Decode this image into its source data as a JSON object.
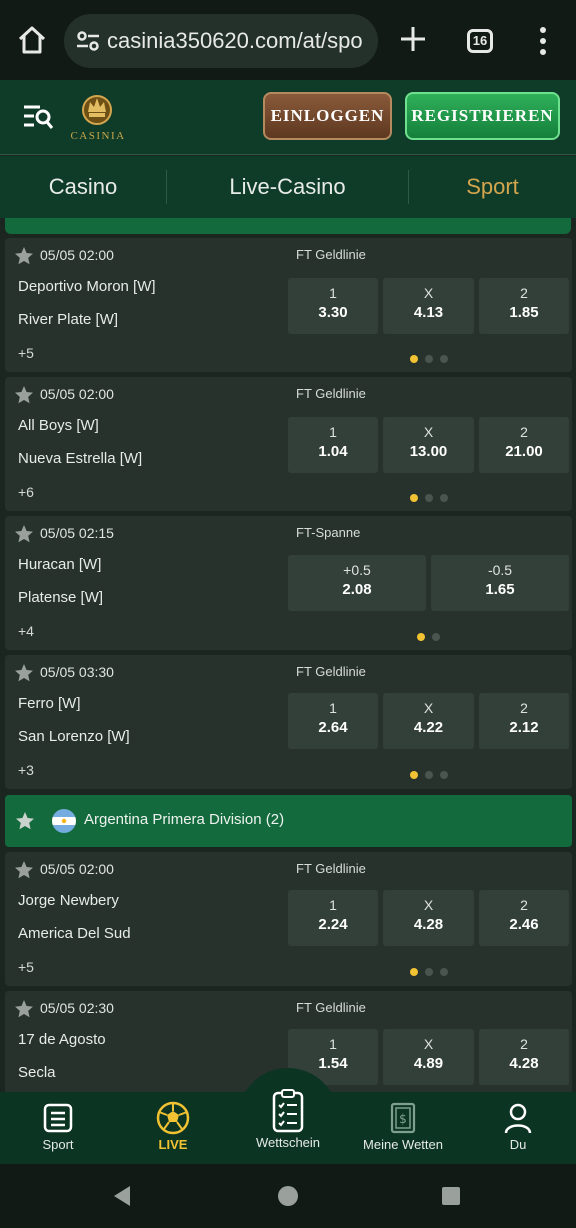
{
  "browser": {
    "url": "casinia350620.com/at/spo",
    "tab_count": "16"
  },
  "header": {
    "logo_text": "CASINIA",
    "login_label": "EINLOGGEN",
    "register_label": "REGISTRIEREN"
  },
  "nav": {
    "tabs": [
      "Casino",
      "Live-Casino",
      "Sport"
    ],
    "active": "Sport"
  },
  "matches": [
    {
      "datetime": "05/05  02:00",
      "market": "FT Geldlinie",
      "home": "Deportivo Moron [W]",
      "away": "River Plate [W]",
      "more": "+5",
      "odds": [
        {
          "label": "1",
          "value": "3.30"
        },
        {
          "label": "X",
          "value": "4.13"
        },
        {
          "label": "2",
          "value": "1.85"
        }
      ]
    },
    {
      "datetime": "05/05  02:00",
      "market": "FT Geldlinie",
      "home": "All Boys [W]",
      "away": "Nueva Estrella [W]",
      "more": "+6",
      "odds": [
        {
          "label": "1",
          "value": "1.04"
        },
        {
          "label": "X",
          "value": "13.00"
        },
        {
          "label": "2",
          "value": "21.00"
        }
      ]
    },
    {
      "datetime": "05/05  02:15",
      "market": "FT-Spanne",
      "home": "Huracan [W]",
      "away": "Platense [W]",
      "more": "+4",
      "odds": [
        {
          "label": "+0.5",
          "value": "2.08"
        },
        {
          "label": "-0.5",
          "value": "1.65"
        }
      ]
    },
    {
      "datetime": "05/05  03:30",
      "market": "FT Geldlinie",
      "home": "Ferro [W]",
      "away": "San Lorenzo [W]",
      "more": "+3",
      "odds": [
        {
          "label": "1",
          "value": "2.64"
        },
        {
          "label": "X",
          "value": "4.22"
        },
        {
          "label": "2",
          "value": "2.12"
        }
      ]
    },
    {
      "datetime": "05/05  02:00",
      "market": "FT Geldlinie",
      "home": "Jorge Newbery",
      "away": "America Del Sud",
      "more": "+5",
      "odds": [
        {
          "label": "1",
          "value": "2.24"
        },
        {
          "label": "X",
          "value": "4.28"
        },
        {
          "label": "2",
          "value": "2.46"
        }
      ]
    },
    {
      "datetime": "05/05  02:30",
      "market": "FT Geldlinie",
      "home": "17 de Agosto",
      "away": "Secla",
      "more": "",
      "odds": [
        {
          "label": "1",
          "value": "1.54"
        },
        {
          "label": "X",
          "value": "4.89"
        },
        {
          "label": "2",
          "value": "4.28"
        }
      ]
    }
  ],
  "league": {
    "name": "Argentina Primera Division (2)"
  },
  "bottom_nav": {
    "sport": "Sport",
    "live": "LIVE",
    "betslip": "Wettschein",
    "my_bets": "Meine Wetten",
    "profile": "Du"
  },
  "colors": {
    "gold": "#d4a64e",
    "live_yellow": "#f1c232",
    "header_green": "#0f3b29",
    "league_green": "#136b3d"
  }
}
